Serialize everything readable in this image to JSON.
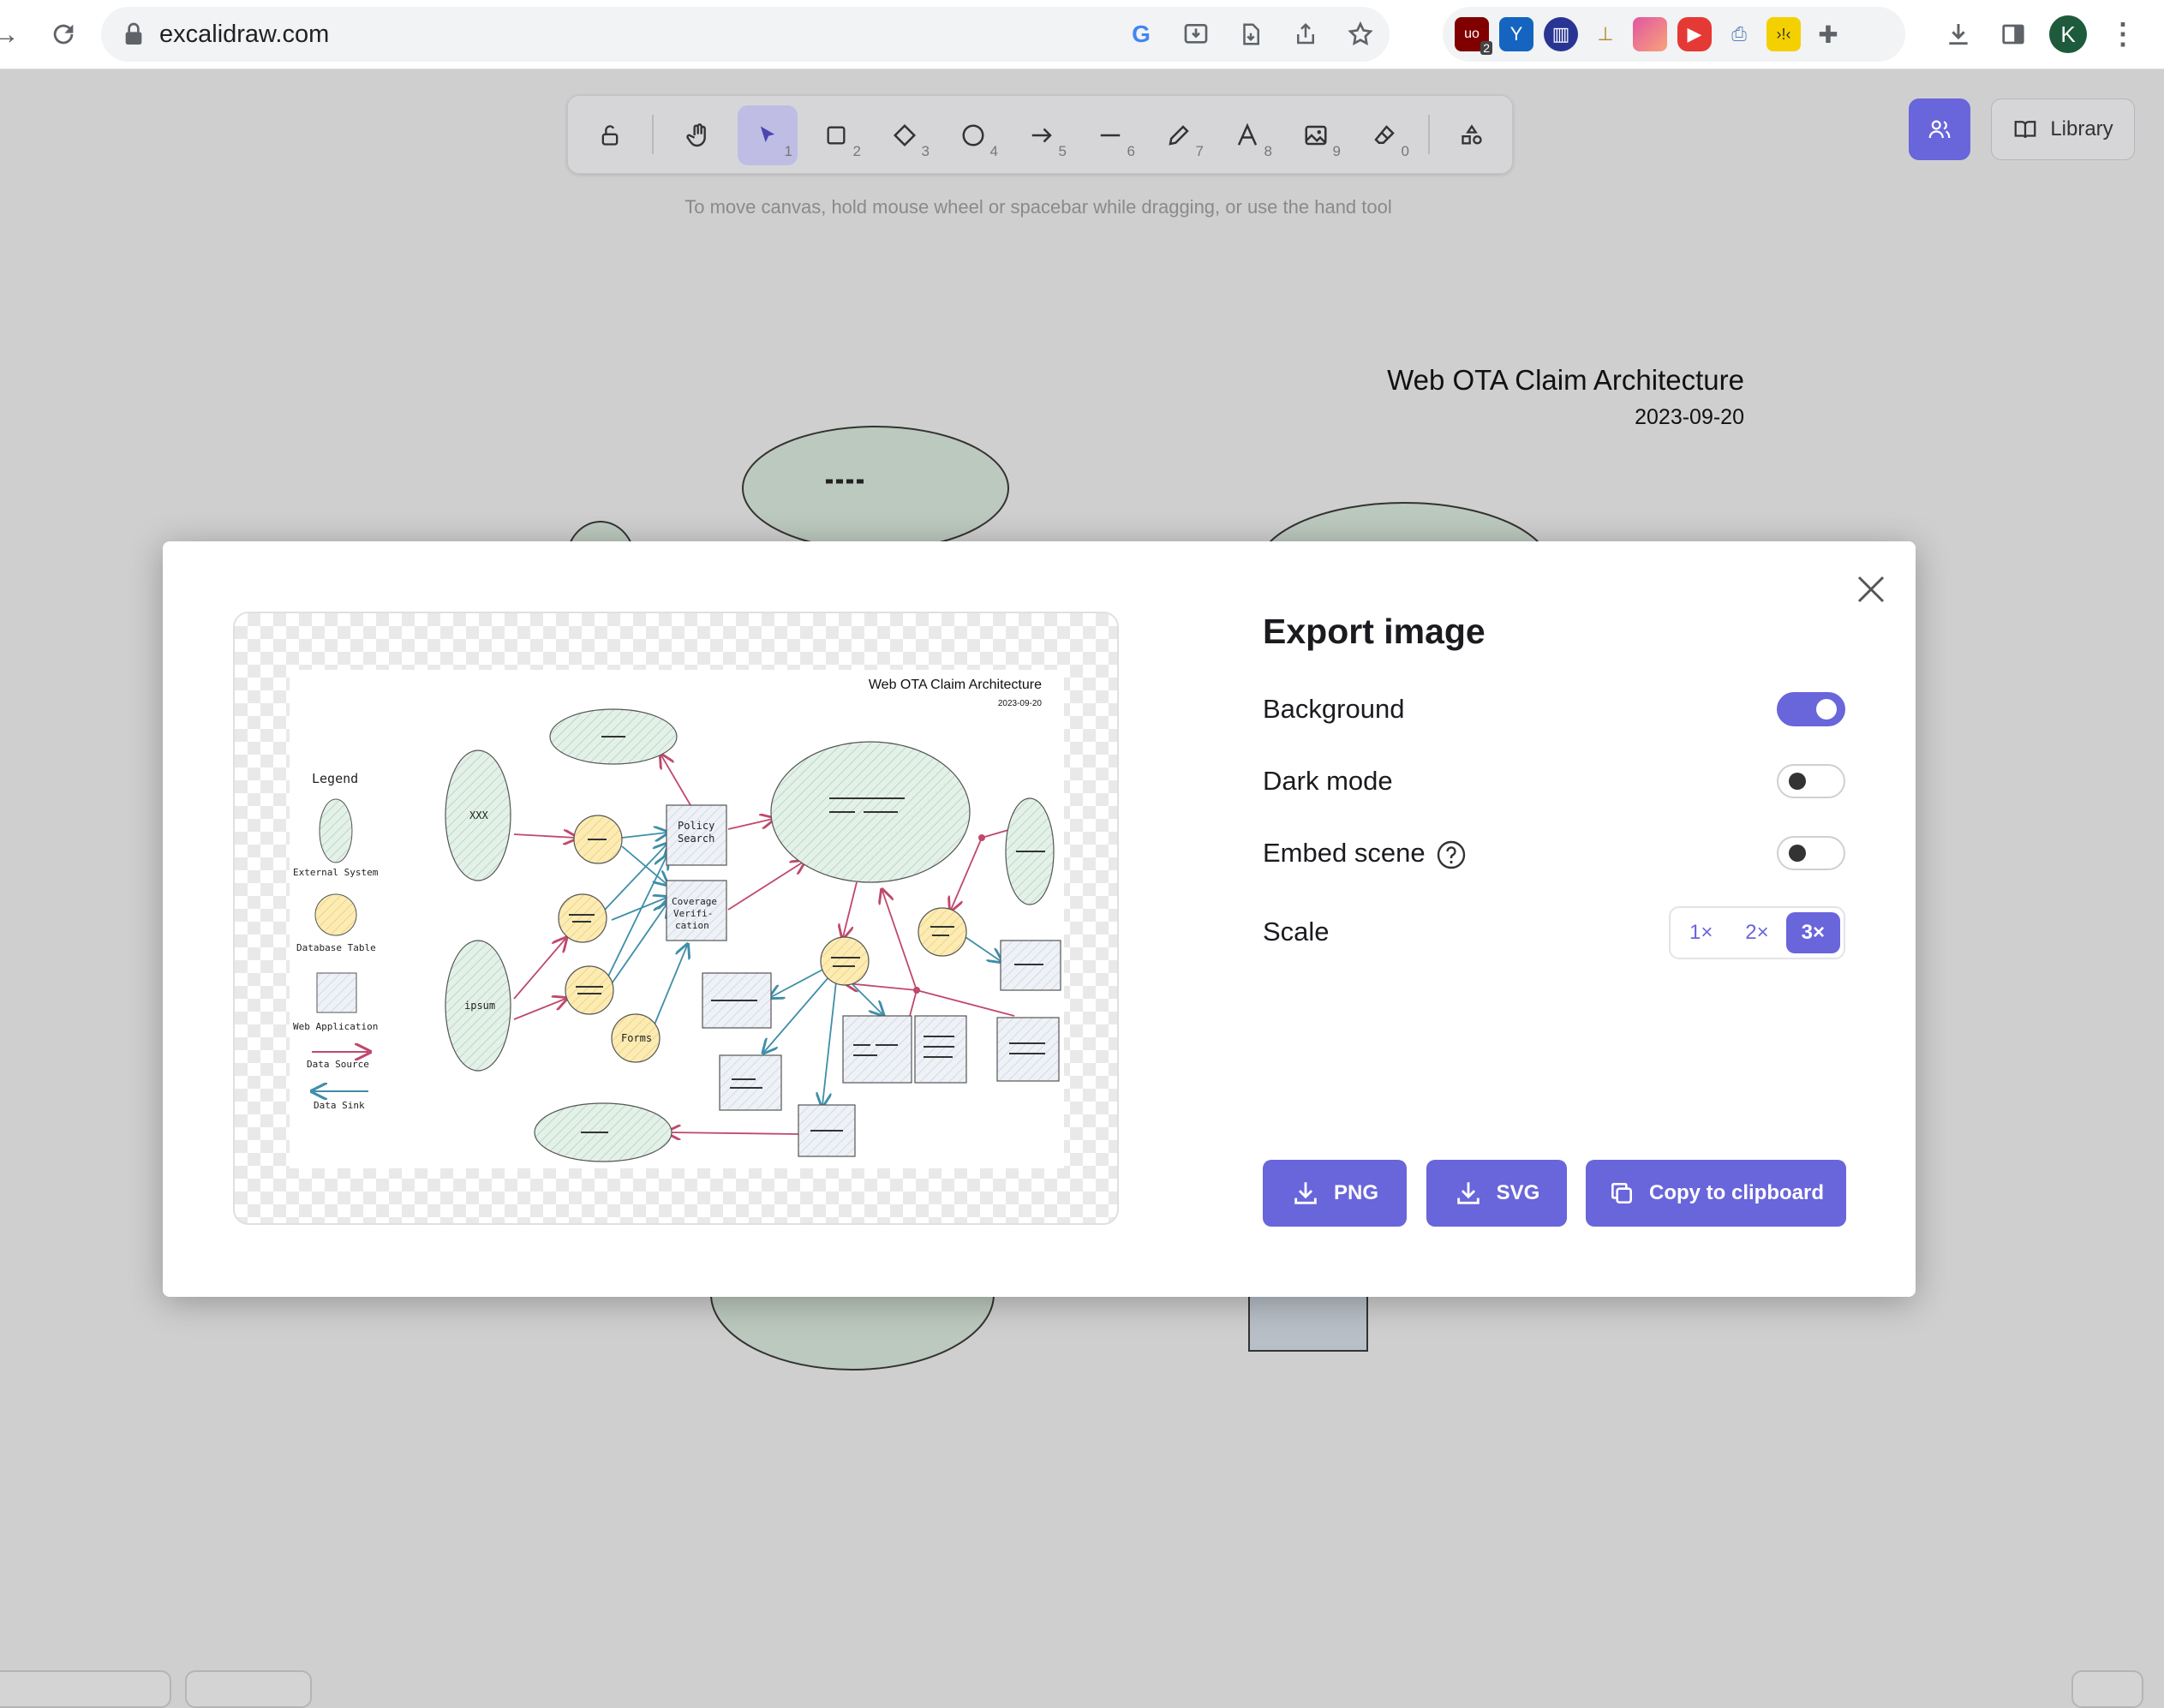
{
  "browser": {
    "url": "excalidraw.com",
    "ext_badge": "2",
    "avatar_initial": "K"
  },
  "toolbar": {
    "tools": [
      {
        "name": "hand",
        "num": ""
      },
      {
        "name": "select",
        "num": "1"
      },
      {
        "name": "rectangle",
        "num": "2"
      },
      {
        "name": "diamond",
        "num": "3"
      },
      {
        "name": "ellipse",
        "num": "4"
      },
      {
        "name": "arrow",
        "num": "5"
      },
      {
        "name": "line",
        "num": "6"
      },
      {
        "name": "draw",
        "num": "7"
      },
      {
        "name": "text",
        "num": "8"
      },
      {
        "name": "image",
        "num": "9"
      },
      {
        "name": "eraser",
        "num": "0"
      }
    ],
    "hint": "To move canvas, hold mouse wheel or spacebar while dragging, or use the hand tool",
    "library_label": "Library"
  },
  "canvas": {
    "title": "Web OTA Claim Architecture",
    "date": "2023-09-20"
  },
  "modal": {
    "title": "Export image",
    "options": {
      "background": {
        "label": "Background",
        "on": true
      },
      "dark_mode": {
        "label": "Dark mode",
        "on": false
      },
      "embed_scene": {
        "label": "Embed scene",
        "on": false
      }
    },
    "scale": {
      "label": "Scale",
      "options": [
        "1×",
        "2×",
        "3×"
      ],
      "selected": "3×"
    },
    "buttons": {
      "png": "PNG",
      "svg": "SVG",
      "clipboard": "Copy to clipboard"
    },
    "preview": {
      "title": "Web OTA Claim Architecture",
      "date": "2023-09-20",
      "legend": {
        "heading": "Legend",
        "external_system": "External System",
        "database_table": "Database Table",
        "web_application": "Web Application",
        "data_source": "Data Source",
        "data_sink": "Data Sink"
      },
      "nodes": {
        "xxx": "XXX",
        "ipsum": "ipsum",
        "forms": "Forms",
        "policy_search_1": "Policy",
        "policy_search_2": "Search",
        "coverage_1": "Coverage",
        "coverage_2": "Verifi-",
        "coverage_3": "cation"
      }
    }
  }
}
